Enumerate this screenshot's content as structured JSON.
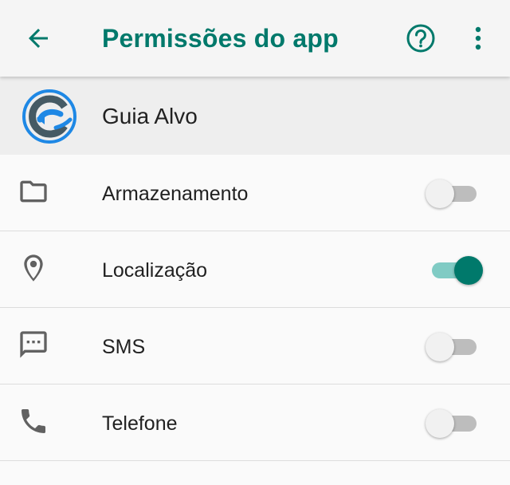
{
  "toolbar": {
    "title": "Permissões do app",
    "back_icon": "arrow-back-icon",
    "help_icon": "help-circle-icon",
    "more_icon": "more-vert-icon",
    "accent_color": "#00796b"
  },
  "app": {
    "name": "Guia Alvo",
    "logo_icon": "app-logo-icon"
  },
  "permissions": [
    {
      "label": "Armazenamento",
      "icon": "folder-icon",
      "enabled": false
    },
    {
      "label": "Localização",
      "icon": "location-pin-icon",
      "enabled": true
    },
    {
      "label": "SMS",
      "icon": "sms-icon",
      "enabled": false
    },
    {
      "label": "Telefone",
      "icon": "phone-icon",
      "enabled": false
    }
  ]
}
